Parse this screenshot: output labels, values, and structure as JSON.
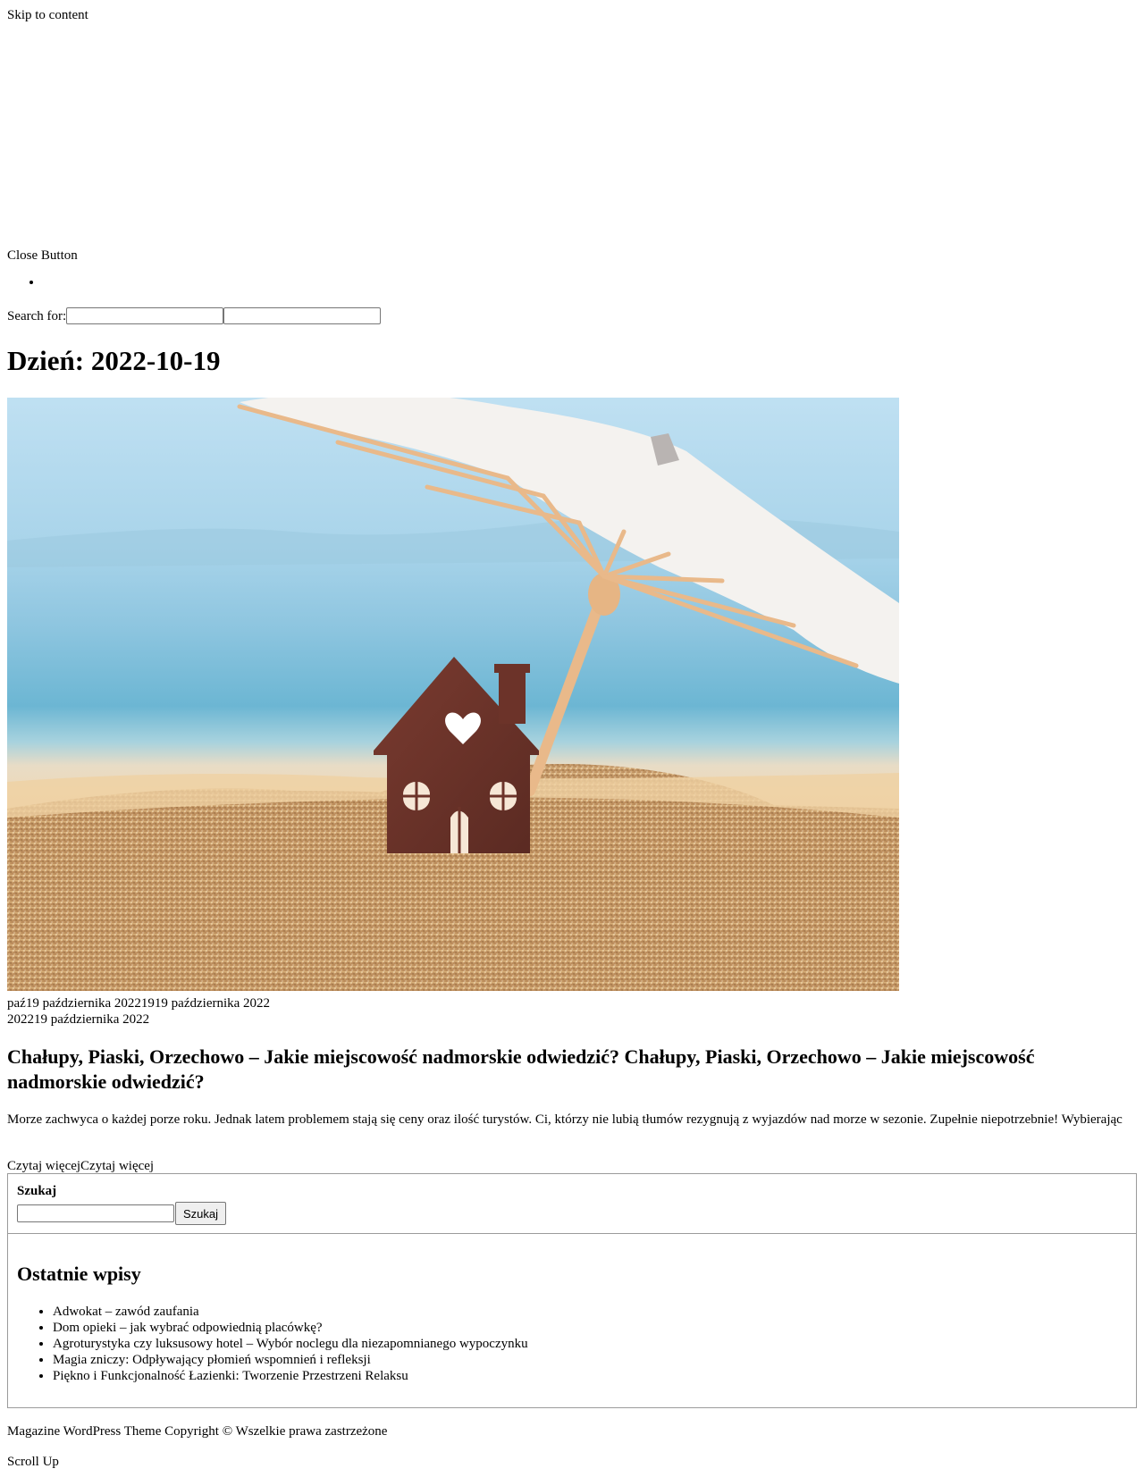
{
  "skip_link": "Skip to content",
  "close_button": "Close Button",
  "search_top": {
    "label": "Search for:",
    "value": "",
    "submit_value": ""
  },
  "archive_title": "Dzień: 2022-10-19",
  "post": {
    "meta_line1": "paź19 października 20221919 października 2022",
    "meta_line2": "202219 października 2022",
    "title": "Chałupy, Piaski, Orzechowo – Jakie miejscowość nadmorskie odwiedzić?  Chałupy, Piaski, Orzechowo – Jakie miejscowość nadmorskie odwiedzić?",
    "excerpt": "Morze zachwyca o każdej porze roku. Jednak latem problemem stają się ceny oraz ilość turystów. Ci, którzy nie lubią tłumów rezygnują z wyjazdów nad morze w sezonie. Zupełnie niepotrzebnie! Wybierając",
    "read_more": "Czytaj więcejCzytaj więcej",
    "image_desc_icon": "beach-house-umbrella-photo"
  },
  "sidebar": {
    "search": {
      "label": "Szukaj",
      "button": "Szukaj",
      "value": ""
    },
    "recent": {
      "title": "Ostatnie wpisy",
      "items": [
        "Adwokat – zawód zaufania",
        "Dom opieki – jak wybrać odpowiednią placówkę?",
        "Agroturystyka czy luksusowy hotel – Wybór noclegu dla niezapomnianego wypoczynku",
        "Magia zniczy: Odpływający płomień wspomnień i refleksji",
        "Piękno i Funkcjonalność Łazienki: Tworzenie Przestrzeni Relaksu"
      ]
    }
  },
  "footer": "Magazine WordPress Theme Copyright © Wszelkie prawa zastrzeżone",
  "scroll_up": "Scroll Up"
}
